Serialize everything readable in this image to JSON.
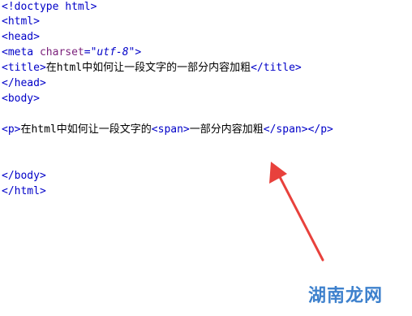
{
  "code": {
    "doctype": "<!doctype html>",
    "html_open": "<html>",
    "head_open": "<head>",
    "meta_open": "<meta ",
    "meta_attr": "charset",
    "meta_eq": "=",
    "meta_val": "\"utf-8\"",
    "meta_close": ">",
    "title_open": "<title>",
    "title_text": "在html中如何让一段文字的一部分内容加粗",
    "title_close": "</title>",
    "head_close": "</head>",
    "body_open": "<body>",
    "p_open": "<p>",
    "p_text_1": "在html中如何让一段文字的",
    "span_open": "<span>",
    "span_text": "一部分内容加粗",
    "span_close": "</span>",
    "p_close": "</p>",
    "body_close": "</body>",
    "html_close": "</html>"
  },
  "watermark": {
    "text": "湖南龙网"
  },
  "colors": {
    "tag": "#0000c8",
    "attr": "#7a1f7a",
    "arrow": "#e8413c"
  }
}
